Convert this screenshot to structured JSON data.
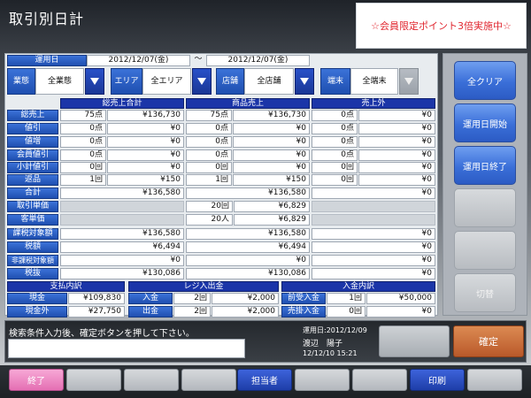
{
  "header": {
    "title": "取引別日計",
    "promo": "☆会員限定ポイント3倍実施中☆"
  },
  "filters": {
    "date_label": "運用日",
    "date_from": "2012/12/07(金)",
    "date_sep": "～",
    "date_to": "2012/12/07(金)",
    "business_label": "業態",
    "business_value": "全業態",
    "area_label": "エリア",
    "area_value": "全エリア",
    "store_label": "店舗",
    "store_value": "全店舗",
    "terminal_label": "端末",
    "terminal_value": "全端末"
  },
  "table": {
    "col_headers": [
      "総売上合計",
      "商品売上",
      "売上外"
    ],
    "rows": [
      {
        "label": "総売上",
        "c1q": "75点",
        "c1v": "¥136,730",
        "c2q": "75点",
        "c2v": "¥136,730",
        "c3q": "0点",
        "c3v": "¥0"
      },
      {
        "label": "値引",
        "c1q": "0点",
        "c1v": "¥0",
        "c2q": "0点",
        "c2v": "¥0",
        "c3q": "0点",
        "c3v": "¥0"
      },
      {
        "label": "値増",
        "c1q": "0点",
        "c1v": "¥0",
        "c2q": "0点",
        "c2v": "¥0",
        "c3q": "0点",
        "c3v": "¥0"
      },
      {
        "label": "会員値引",
        "c1q": "0点",
        "c1v": "¥0",
        "c2q": "0点",
        "c2v": "¥0",
        "c3q": "0点",
        "c3v": "¥0"
      },
      {
        "label": "小計値引",
        "c1q": "0回",
        "c1v": "¥0",
        "c2q": "0回",
        "c2v": "¥0",
        "c3q": "0回",
        "c3v": "¥0"
      },
      {
        "label": "返品",
        "c1q": "1回",
        "c1v": "¥150",
        "c2q": "1回",
        "c2v": "¥150",
        "c3q": "0回",
        "c3v": "¥0"
      }
    ],
    "total": {
      "label": "合計",
      "c1": "¥136,580",
      "c2": "¥136,580",
      "c3": "¥0"
    },
    "avg_price": {
      "label": "取引単価",
      "q": "20回",
      "v": "¥6,829"
    },
    "avg_customer": {
      "label": "客単価",
      "q": "20人",
      "v": "¥6,829"
    },
    "taxable": {
      "label": "課税対象額",
      "c1": "¥136,580",
      "c2": "¥136,580",
      "c3": "¥0"
    },
    "tax": {
      "label": "税額",
      "c1": "¥6,494",
      "c2": "¥6,494",
      "c3": "¥0"
    },
    "nontaxable": {
      "label": "非課税対象額",
      "c1": "¥0",
      "c2": "¥0",
      "c3": "¥0"
    },
    "pretax": {
      "label": "税抜",
      "c1": "¥130,086",
      "c2": "¥130,086",
      "c3": "¥0"
    }
  },
  "payment": {
    "header": "支払内訳",
    "rows": [
      {
        "label": "現金",
        "v": "¥109,830"
      },
      {
        "label": "現金外",
        "v": "¥27,750"
      }
    ]
  },
  "register": {
    "header": "レジ入出金",
    "rows": [
      {
        "label": "入金",
        "q": "2回",
        "v": "¥2,000"
      },
      {
        "label": "出金",
        "q": "2回",
        "v": "¥2,000"
      }
    ]
  },
  "deposit": {
    "header": "入金内訳",
    "rows": [
      {
        "label": "前受入金",
        "q": "1回",
        "v": "¥50,000"
      },
      {
        "label": "売掛入金",
        "q": "0回",
        "v": "¥0"
      }
    ]
  },
  "side_buttons": {
    "clear": "全クリア",
    "start": "運用日開始",
    "end": "運用日終了",
    "switch": "切替"
  },
  "message": {
    "text": "検索条件入力後、確定ボタンを押して下さい。",
    "input_value": ""
  },
  "info": {
    "date": "運用日:2012/12/09",
    "user": "渡辺　陽子",
    "datetime": "12/12/10 15:21"
  },
  "confirm_label": "確定",
  "footer": {
    "exit": "終了",
    "staff": "担当者",
    "print": "印刷"
  },
  "colors": {
    "promo_text": "#e0252e",
    "accent_blue": "#1f4fb0",
    "confirm": "#c2672f",
    "exit_pink": "#e46fb3"
  }
}
